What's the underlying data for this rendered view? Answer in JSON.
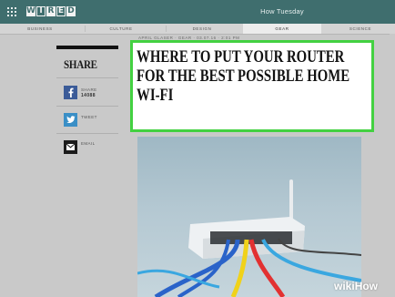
{
  "header": {
    "logo_letters": [
      "W",
      "I",
      "R",
      "E",
      "D"
    ],
    "title": "How Tuesday"
  },
  "nav": {
    "items": [
      "BUSINESS",
      "CULTURE",
      "DESIGN",
      "GEAR",
      "SCIENCE"
    ],
    "active": "GEAR"
  },
  "article": {
    "byline": "APRIL GLASER · GEAR · 03.07.16 · 2:01 PM",
    "headline_lines": [
      "WHERE TO PUT YOUR ROUTER",
      "FOR THE BEST POSSIBLE HOME",
      "WI-FI"
    ]
  },
  "share": {
    "title": "SHARE",
    "facebook": {
      "label": "SHARE",
      "count": "14088"
    },
    "twitter": {
      "label": "TWEET"
    },
    "email": {
      "label": "EMAIL"
    }
  },
  "photo": {
    "icons": [
      "wifi-router",
      "network-cables"
    ],
    "cable_colors": [
      "#2a63c9",
      "#e23131",
      "#f0d21a",
      "#3aa7e0",
      "#888888"
    ]
  },
  "watermark": {
    "wiki": "wiki",
    "how": "How"
  },
  "colors": {
    "topbar": "#3f6e6e",
    "highlight": "#43d141"
  }
}
